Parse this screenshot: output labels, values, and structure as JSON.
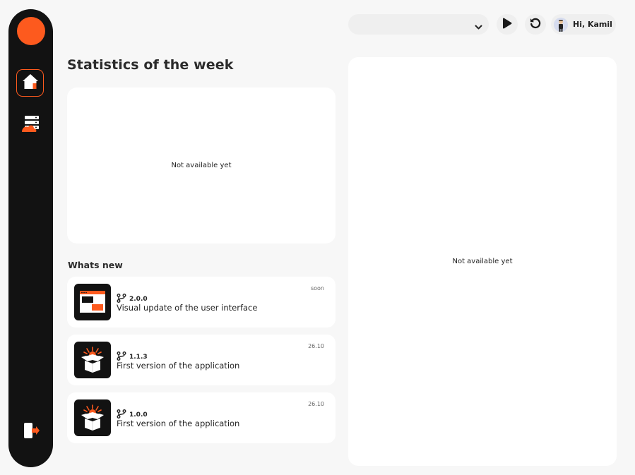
{
  "user": {
    "greeting": "Hi, Kamil"
  },
  "main": {
    "title": "Statistics of the week",
    "stats_placeholder": "Not available yet"
  },
  "side_panel": {
    "placeholder": "Not available yet"
  },
  "whats_new": {
    "title": "Whats new",
    "items": [
      {
        "version": "2.0.0",
        "description": "Visual update of the user interface",
        "date": "soon",
        "icon": "ui-window-icon"
      },
      {
        "version": "1.1.3",
        "description": "First version of the application",
        "date": "26.10",
        "icon": "open-box-icon"
      },
      {
        "version": "1.0.0",
        "description": "First version of the application",
        "date": "26.10",
        "icon": "open-box-icon"
      }
    ]
  },
  "colors": {
    "accent": "#fd5a1e",
    "sidebar": "#121212",
    "background": "#f7f7f7",
    "card": "#ffffff"
  }
}
